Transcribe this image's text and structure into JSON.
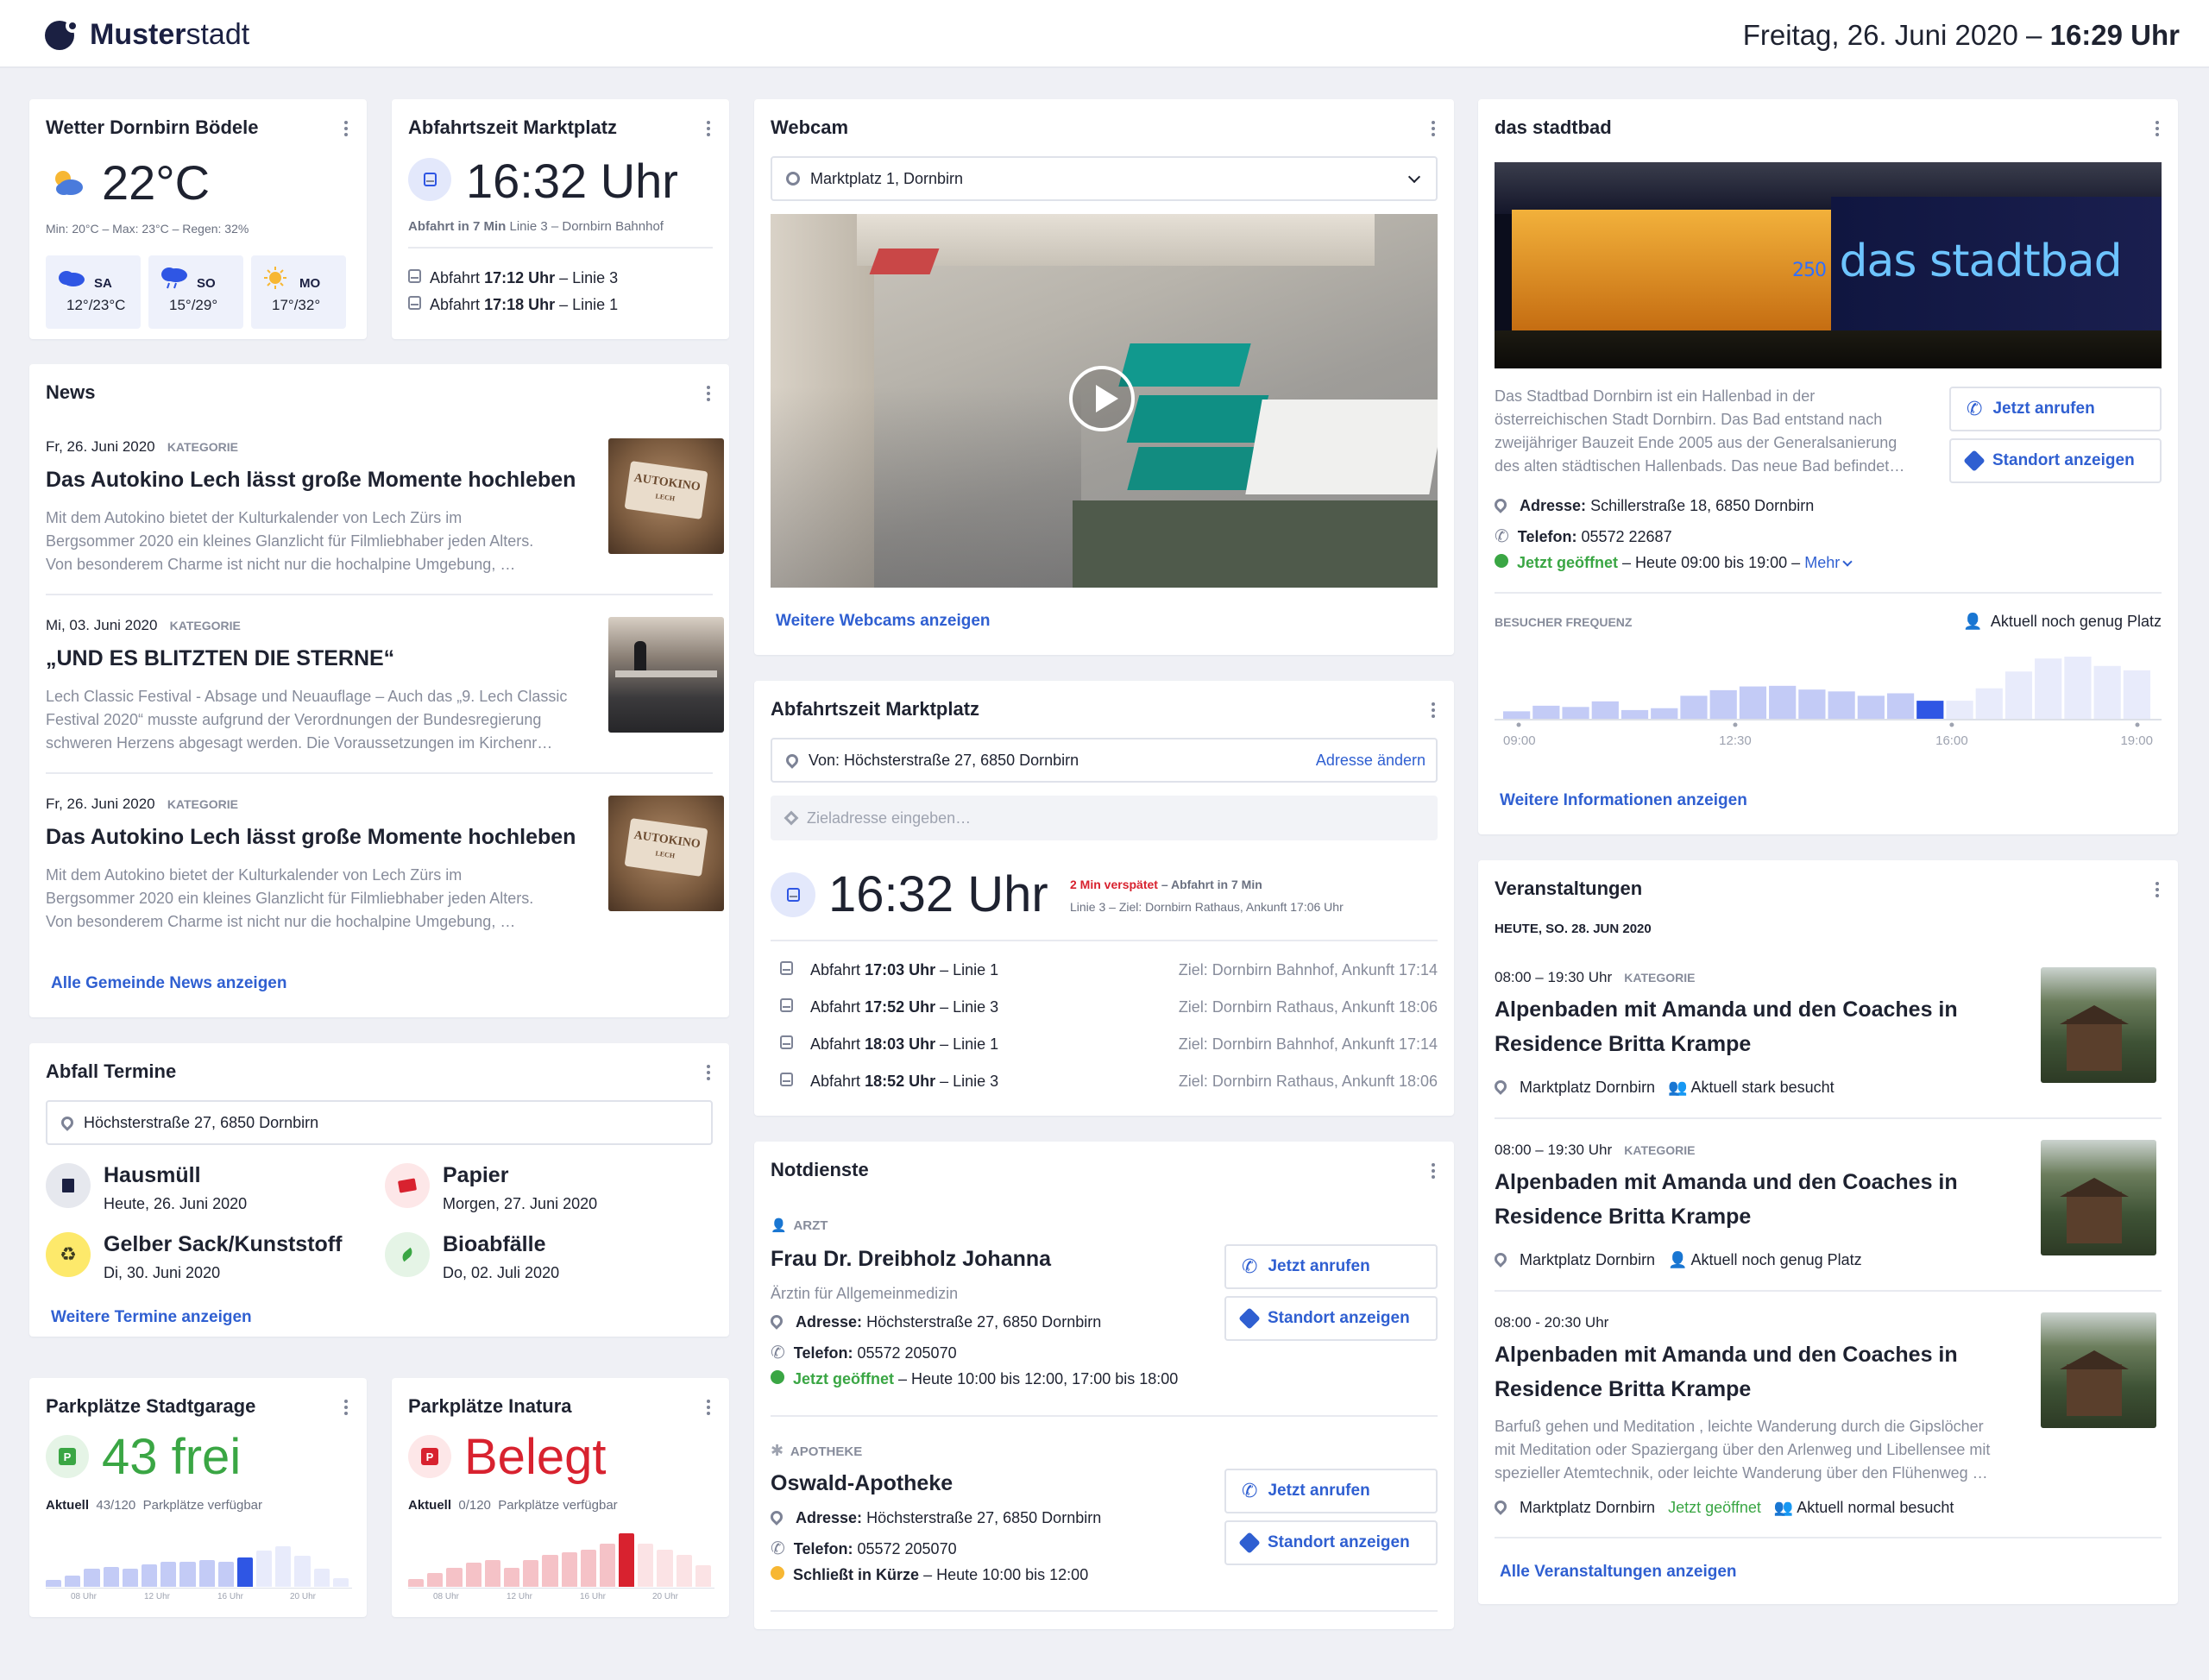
{
  "header": {
    "brand_bold": "Muster",
    "brand_rest": "stadt",
    "date": "Freitag, 26. Juni 2020 –",
    "time": "16:29 Uhr"
  },
  "weather": {
    "title": "Wetter Dornbirn Bödele",
    "temp": "22°C",
    "details": "Min: 20°C – Max: 23°C – Regen: 32%",
    "days": [
      {
        "day": "SA",
        "range": "12°/23°C",
        "icon": "cloud-icon"
      },
      {
        "day": "SO",
        "range": "15°/29°",
        "icon": "rain-cloud-icon"
      },
      {
        "day": "MO",
        "range": "17°/32°",
        "icon": "sun-icon"
      }
    ]
  },
  "depart_small": {
    "title": "Abfahrtszeit Marktplatz",
    "time": "16:32 Uhr",
    "sub_bold": "Abfahrt in 7 Min",
    "sub_rest": "Linie 3 – Dornbirn Bahnhof",
    "rows": [
      {
        "pre": "Abfahrt",
        "time": "17:12 Uhr",
        "line": "– Linie 3"
      },
      {
        "pre": "Abfahrt",
        "time": "17:18 Uhr",
        "line": "– Linie 1"
      }
    ]
  },
  "news": {
    "title": "News",
    "more": "Alle Gemeinde News anzeigen",
    "items": [
      {
        "date": "Fr, 26. Juni 2020",
        "cat": "KATEGORIE",
        "title": "Das Autokino Lech lässt große Momente hochleben",
        "text1": "Mit dem Autokino bietet der Kulturkalender von Lech Zürs im",
        "text2": "Bergsommer 2020 ein kleines Glanzlicht für Filmliebhaber jeden Alters.",
        "text3": "Von besonderem Charme ist nicht nur die hochalpine Umgebung, …",
        "img": "autokino"
      },
      {
        "date": "Mi, 03. Juni 2020",
        "cat": "KATEGORIE",
        "title": "„UND ES BLITZTEN DIE STERNE“",
        "text1": "Lech Classic Festival - Absage und Neuauflage – Auch das „9. Lech Classic",
        "text2": "Festival 2020“ musste aufgrund der Verordnungen der Bundesregierung",
        "text3": "schweren Herzens abgesagt werden. Die Voraussetzungen im Kirchenr…",
        "img": "concert"
      },
      {
        "date": "Fr, 26. Juni 2020",
        "cat": "KATEGORIE",
        "title": "Das Autokino Lech lässt große Momente hochleben",
        "text1": "Mit dem Autokino bietet der Kulturkalender von Lech Zürs im",
        "text2": "Bergsommer 2020 ein kleines Glanzlicht für Filmliebhaber jeden Alters.",
        "text3": "Von besonderem Charme ist nicht nur die hochalpine Umgebung, …",
        "img": "autokino"
      }
    ],
    "autokino_sign": "AUTOKINO",
    "autokino_sub": "LECH"
  },
  "waste": {
    "title": "Abfall Termine",
    "address": "Höchsterstraße 27, 6850 Dornbirn",
    "more": "Weitere Termine anzeigen",
    "items": [
      {
        "name": "Hausmüll",
        "date": "Heute, 26. Juni 2020",
        "icon": "trash-icon",
        "color": "#e6e8ee"
      },
      {
        "name": "Papier",
        "date": "Morgen, 27. Juni 2020",
        "icon": "paper-icon",
        "color": "#fde7e8"
      },
      {
        "name": "Gelber Sack/Kunststoff",
        "date": "Di, 30. Juni 2020",
        "icon": "recycle-icon",
        "color": "#fde96b"
      },
      {
        "name": "Bioabfälle",
        "date": "Do, 02. Juli 2020",
        "icon": "leaf-icon",
        "color": "#e5f4e6"
      }
    ]
  },
  "park1": {
    "title": "Parkplätze Stadtgarage",
    "value": "43 frei",
    "cur_label": "Aktuell",
    "cur_count": "43/120",
    "cur_rest": "Parkplätze verfügbar",
    "ticks": [
      "08 Uhr",
      "12 Uhr",
      "16 Uhr",
      "20 Uhr"
    ]
  },
  "park2": {
    "title": "Parkplätze Inatura",
    "value": "Belegt",
    "cur_label": "Aktuell",
    "cur_count": "0/120",
    "cur_rest": "Parkplätze verfügbar",
    "ticks": [
      "08 Uhr",
      "12 Uhr",
      "16 Uhr",
      "20 Uhr"
    ]
  },
  "webcam": {
    "title": "Webcam",
    "location": "Marktplatz 1, Dornbirn",
    "more": "Weitere Webcams anzeigen"
  },
  "depart_big": {
    "title": "Abfahrtszeit Marktplatz",
    "from": "Von: Höchsterstraße 27, 6850 Dornbirn",
    "change": "Adresse ändern",
    "dest_placeholder": "Zieladresse eingeben…",
    "time": "16:32 Uhr",
    "delay": "2 Min verspätet",
    "delay_rest": "– Abfahrt in 7 Min",
    "line": "Linie 3 – Ziel: Dornbirn Rathaus, Ankunft 17:06 Uhr",
    "rows": [
      {
        "pre": "Abfahrt",
        "time": "17:03 Uhr",
        "line": "– Linie 1",
        "dest": "Ziel:  Dornbirn Bahnhof, Ankunft 17:14"
      },
      {
        "pre": "Abfahrt",
        "time": "17:52 Uhr",
        "line": "– Linie 3",
        "dest": "Ziel: Dornbirn Rathaus, Ankunft 18:06"
      },
      {
        "pre": "Abfahrt",
        "time": "18:03 Uhr",
        "line": "– Linie 1",
        "dest": "Ziel:  Dornbirn Bahnhof, Ankunft 17:14"
      },
      {
        "pre": "Abfahrt",
        "time": "18:52 Uhr",
        "line": "– Linie 3",
        "dest": "Ziel: Dornbirn Rathaus, Ankunft 18:06"
      }
    ]
  },
  "emergency": {
    "title": "Notdienste",
    "call": "Jetzt anrufen",
    "location": "Standort anzeigen",
    "doctor": {
      "cat": "ARZT",
      "name": "Frau Dr. Dreibholz Johanna",
      "desc": "Ärztin für Allgemeinmedizin",
      "addr_l": "Adresse:",
      "addr": "Höchsterstraße 27, 6850 Dornbirn",
      "tel_l": "Telefon:",
      "tel": "05572 205070",
      "open": "Jetzt geöffnet",
      "hours": "– Heute 10:00 bis 12:00, 17:00 bis 18:00"
    },
    "pharmacy": {
      "cat": "APOTHEKE",
      "name": "Oswald-Apotheke",
      "addr_l": "Adresse:",
      "addr": "Höchsterstraße 27, 6850 Dornbirn",
      "tel_l": "Telefon:",
      "tel": "05572 205070",
      "open": "Schließt in Kürze",
      "hours": "– Heute 10:00 bis 12:00"
    }
  },
  "stadtbad": {
    "title": "das stadtbad",
    "sign": "das stadtbad",
    "sign_num": "250",
    "desc1": "Das Stadtbad Dornbirn ist ein Hallenbad in der",
    "desc2": "österreichischen Stadt Dornbirn. Das Bad entstand nach",
    "desc3": "zweijähriger Bauzeit Ende 2005 aus der Generalsanierung",
    "desc4": "des alten städtischen Hallenbads. Das neue Bad befindet…",
    "call": "Jetzt anrufen",
    "location": "Standort anzeigen",
    "addr_l": "Adresse:",
    "addr": "Schillerstraße 18, 6850 Dornbirn",
    "tel_l": "Telefon:",
    "tel": "05572 22687",
    "open": "Jetzt geöffnet",
    "hours": "– Heute 09:00 bis 19:00 –",
    "mehr": "Mehr",
    "freq_label": "BESUCHER FREQUENZ",
    "status": "Aktuell noch genug Platz",
    "more": "Weitere Informationen anzeigen"
  },
  "events": {
    "title": "Veranstaltungen",
    "day": "HEUTE, SO. 28. JUN 2020",
    "more": "Alle Veranstaltungen anzeigen",
    "items": [
      {
        "time": "08:00 – 19:30 Uhr",
        "cat": "KATEGORIE",
        "t1": "Alpenbaden mit Amanda und den Coaches in",
        "t2": "Residence Britta Krampe",
        "place": "Marktplatz Dornbirn",
        "crowd": "Aktuell stark besucht"
      },
      {
        "time": "08:00 – 19:30 Uhr",
        "cat": "KATEGORIE",
        "t1": "Alpenbaden mit Amanda und den Coaches in",
        "t2": "Residence Britta Krampe",
        "place": "Marktplatz Dornbirn",
        "crowd": "Aktuell noch genug Platz"
      },
      {
        "time": "08:00 - 20:30 Uhr",
        "cat": "",
        "t1": "Alpenbaden mit Amanda und den Coaches in",
        "t2": "Residence Britta Krampe",
        "d1": "Barfuß gehen und Meditation , leichte Wanderung durch die Gipslöcher",
        "d2": "mit Meditation oder Spaziergang über den Arlenweg und Libellensee mit",
        "d3": "spezieller Atemtechnik, oder leichte Wanderung über den Flühenweg …",
        "place": "Marktplatz Dornbirn",
        "open": "Jetzt geöffnet",
        "crowd": "Aktuell normal besucht"
      }
    ]
  },
  "chart_data": [
    {
      "type": "bar",
      "name": "Besucher Frequenz",
      "x_ticks": [
        "09:00",
        "12:30",
        "16:00",
        "19:00"
      ],
      "tick_pos": [
        0,
        0.35,
        0.7,
        1
      ],
      "values": [
        0.12,
        0.21,
        0.19,
        0.28,
        0.14,
        0.17,
        0.37,
        0.46,
        0.52,
        0.53,
        0.47,
        0.44,
        0.37,
        0.41,
        0.29,
        0.29,
        0.49,
        0.76,
        0.97,
        1.0,
        0.85,
        0.78
      ],
      "highlight": 14,
      "colors": {
        "past": "#c3cbf6",
        "current": "#2f56e4",
        "future": "#e8ebfb"
      }
    },
    {
      "type": "bar",
      "name": "Parkplätze Stadtgarage",
      "x_ticks": [
        "08 Uhr",
        "12 Uhr",
        "16 Uhr",
        "20 Uhr"
      ],
      "values": [
        0.15,
        0.25,
        0.4,
        0.45,
        0.4,
        0.5,
        0.55,
        0.55,
        0.6,
        0.55,
        0.65,
        0.8,
        0.9,
        0.7,
        0.4,
        0.2
      ],
      "highlight": 10,
      "colors": {
        "past": "#c3cbf6",
        "current": "#2f56e4",
        "future": "#e8ebfb"
      }
    },
    {
      "type": "bar",
      "name": "Parkplätze Inatura",
      "x_ticks": [
        "08 Uhr",
        "12 Uhr",
        "16 Uhr",
        "20 Uhr"
      ],
      "values": [
        0.15,
        0.25,
        0.35,
        0.45,
        0.5,
        0.35,
        0.5,
        0.6,
        0.65,
        0.7,
        0.8,
        1.0,
        0.8,
        0.7,
        0.6,
        0.4
      ],
      "highlight": 11,
      "colors": {
        "past": "#f5c2c7",
        "current": "#d8222f",
        "future": "#fbe3e5"
      }
    }
  ]
}
